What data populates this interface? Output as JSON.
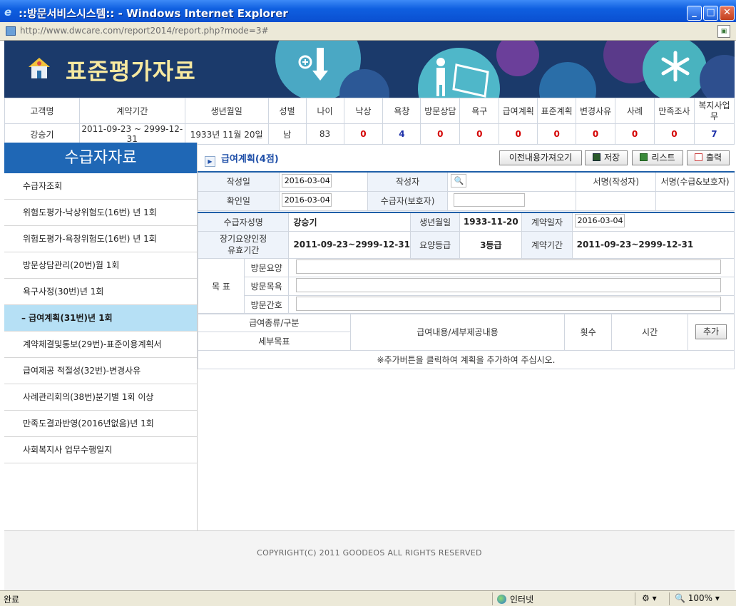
{
  "window": {
    "title": "::방문서비스시스템:: - Windows Internet Explorer",
    "url": "http://www.dwcare.com/report2014/report.php?mode=3#"
  },
  "banner": {
    "title": "표준평가자료"
  },
  "customer": {
    "headers": [
      "고객명",
      "계약기간",
      "생년월일",
      "성별",
      "나이",
      "낙상",
      "욕창",
      "방문상담",
      "욕구",
      "급여계획",
      "표준계획",
      "변경사유",
      "사례",
      "만족조사",
      "복지사업무"
    ],
    "values": [
      "강승기",
      "2011-09-23 ~ 2999-12-31",
      "1933년 11월 20일",
      "남",
      "83",
      "0",
      "4",
      "0",
      "0",
      "0",
      "0",
      "0",
      "0",
      "0",
      "7"
    ]
  },
  "sidebar": {
    "title": "수급자자료",
    "items": [
      "수급자조회",
      "위험도평가-낙상위험도(16번) 년 1회",
      "위험도평가-욕창위험도(16번) 년 1회",
      "방문상담관리(20번)월 1회",
      "욕구사정(30번)년 1회",
      "– 급여계획(31번)년 1회",
      "계약체결및통보(29번)-표준이용계획서",
      "급여제공 적절성(32번)-변경사유",
      "사례관리회의(38번)분기별 1회 이상",
      "만족도결과반영(2016년없음)년 1회",
      "사회복지사 업무수행일지"
    ]
  },
  "panel": {
    "title": "급여계획(4점)",
    "buttons": {
      "load_prev": "이전내용가져오기",
      "save": "저장",
      "list": "리스트",
      "print": "출력"
    }
  },
  "form": {
    "write_date_label": "작성일",
    "write_date": "2016-03-04",
    "writer_label": "작성자",
    "sign_writer_label": "서명(작성자)",
    "sign_guardian_label": "서명(수급&보호자)",
    "confirm_date_label": "확인일",
    "confirm_date": "2016-03-04",
    "recipient_label": "수급자(보호자)",
    "recipient_value": ""
  },
  "info": {
    "name_label": "수급자성명",
    "name": "강승기",
    "birth_label": "생년월일",
    "birth": "1933-11-20",
    "contract_date_label": "계약일자",
    "contract_date": "2016-03-04",
    "ltc_label_1": "장기요양인정",
    "ltc_label_2": "유효기간",
    "ltc_period": "2011-09-23~2999-12-31",
    "grade_label": "요양등급",
    "grade": "3등급",
    "contract_period_label": "계약기간",
    "contract_period": "2011-09-23~2999-12-31",
    "goal_label": "목 표",
    "goals": [
      {
        "label": "방문요양",
        "value": ""
      },
      {
        "label": "방문목욕",
        "value": ""
      },
      {
        "label": "방문간호",
        "value": ""
      }
    ]
  },
  "plan": {
    "col_type": "급여종류/구분",
    "col_goal": "세부목표",
    "col_content": "급여내용/세부제공내용",
    "col_count": "횟수",
    "col_time": "시간",
    "add_button": "추가",
    "notice": "※추가버튼을 클릭하여 계획을 추가하여 주십시오."
  },
  "footer": {
    "copyright": "COPYRIGHT(C) 2011 GOODEOS ALL RIGHTS RESERVED"
  },
  "statusbar": {
    "status": "완료",
    "zone": "인터넷",
    "zoom": "100%"
  }
}
